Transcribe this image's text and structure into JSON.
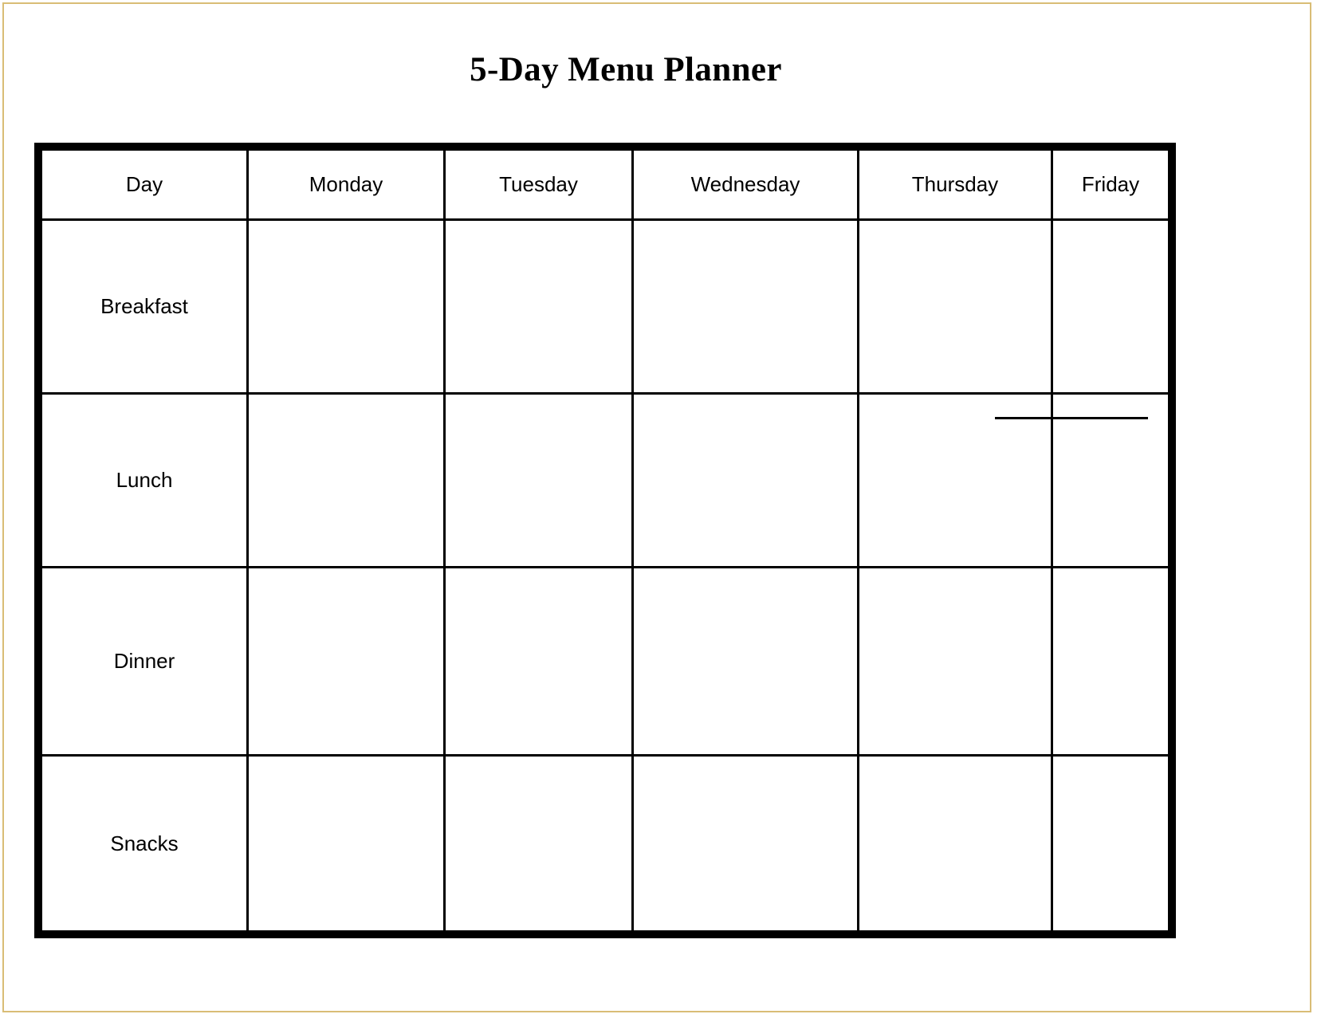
{
  "page": {
    "title": "5-Day Menu Planner",
    "border_color": "#d9bd76",
    "table_border_color": "#000000",
    "background": "#ffffff"
  },
  "table": {
    "columns": [
      {
        "key": "day",
        "label": "Day"
      },
      {
        "key": "monday",
        "label": "Monday"
      },
      {
        "key": "tuesday",
        "label": "Tuesday"
      },
      {
        "key": "wednesday",
        "label": "Wednesday"
      },
      {
        "key": "thursday",
        "label": "Thursday"
      },
      {
        "key": "friday",
        "label": "Friday"
      }
    ],
    "rows": [
      {
        "label": "Breakfast",
        "cells": [
          "",
          "",
          "",
          "",
          ""
        ]
      },
      {
        "label": "Lunch",
        "cells": [
          "",
          "",
          "",
          "",
          ""
        ]
      },
      {
        "label": "Dinner",
        "cells": [
          "",
          "",
          "",
          "",
          ""
        ]
      },
      {
        "label": "Snacks",
        "cells": [
          "",
          "",
          "",
          "",
          ""
        ]
      }
    ]
  }
}
